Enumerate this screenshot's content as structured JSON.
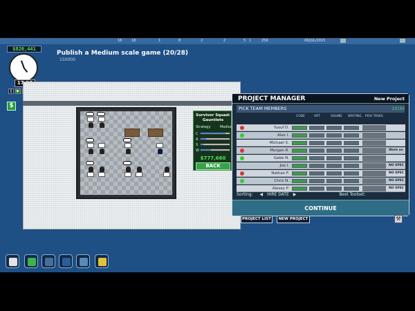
{
  "topbar": {
    "stats": [
      "16",
      "18",
      "1",
      "8",
      "2",
      "2",
      "5",
      "1",
      "259",
      "06/JUL/2015"
    ]
  },
  "money": "$820,441",
  "objective": {
    "title": "Publish a Medium scale game (20/28)",
    "reward": "150000"
  },
  "clock": {
    "time": "17:26"
  },
  "team_panel": {
    "title": "Survivor Squad: Gauntlets",
    "genre": "Strategy",
    "scale": "Medium",
    "skills": [
      {
        "label": "C",
        "level": 0.85
      },
      {
        "label": "A",
        "level": 0.2
      },
      {
        "label": "S",
        "level": 0.1
      },
      {
        "label": "W",
        "level": 0.35
      }
    ],
    "cost": "$777,660",
    "back_label": "BACK"
  },
  "project_manager": {
    "title": "PROJECT MANAGER",
    "new_project": "New Project",
    "subtitle": "PICK TEAM MEMBERS",
    "days": "10/30",
    "columns": [
      "CODE",
      "ART",
      "SOUND",
      "WRITING",
      "PICK TASKS"
    ],
    "members": [
      {
        "name": "Yusuf D.",
        "spec": ""
      },
      {
        "name": "Alex I.",
        "spec": ""
      },
      {
        "name": "Michael X.",
        "spec": ""
      },
      {
        "name": "Morgan R.",
        "spec": "Work on Code"
      },
      {
        "name": "Gabe N.",
        "spec": ""
      },
      {
        "name": "Joe I.",
        "spec": "NO SPEC"
      },
      {
        "name": "Nathan F.",
        "spec": "NO SPEC"
      },
      {
        "name": "Chris N.",
        "spec": "NO SPEC"
      },
      {
        "name": "Alexey P.",
        "spec": "NO SPEC"
      }
    ],
    "sorting_label": "Sorting:",
    "sort_value": "HIRE DATE",
    "best_toolset": "Best Toolset:",
    "continue_label": "CONTINUE"
  },
  "bottom_tabs": {
    "project_list": "PROJECT LIST",
    "new_project": "NEW PROJECT"
  },
  "colors": {
    "accent_green": "#58e058",
    "panel_dark": "#1c2c3f",
    "continue_blue": "#2f6c86"
  }
}
